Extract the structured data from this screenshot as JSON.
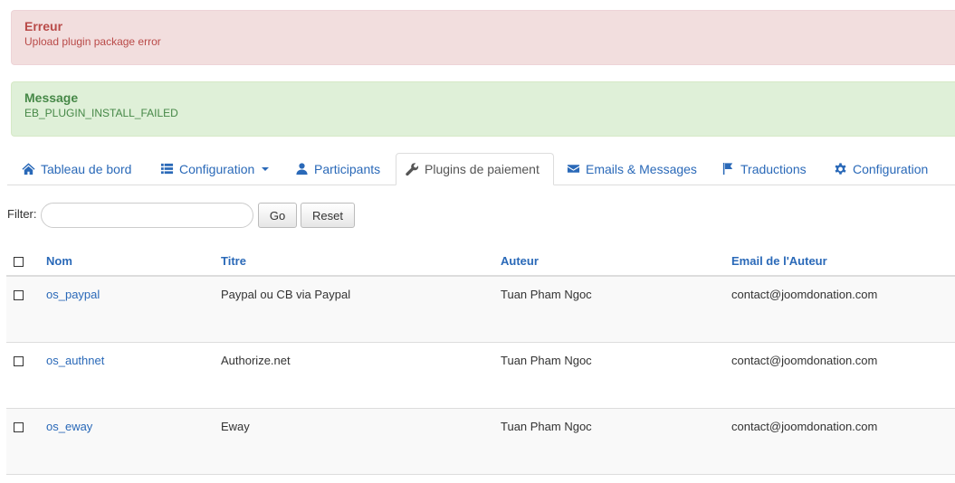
{
  "alerts": {
    "error": {
      "heading": "Erreur",
      "text": "Upload plugin package error"
    },
    "message": {
      "heading": "Message",
      "text": "EB_PLUGIN_INSTALL_FAILED"
    }
  },
  "tabs": [
    {
      "label": "Tableau de bord",
      "icon": "home-icon"
    },
    {
      "label": "Configuration",
      "icon": "list-icon",
      "dropdown": true
    },
    {
      "label": "Participants",
      "icon": "user-icon"
    },
    {
      "label": "Plugins de paiement",
      "icon": "wrench-icon",
      "active": true
    },
    {
      "label": "Emails & Messages",
      "icon": "envelope-icon"
    },
    {
      "label": "Traductions",
      "icon": "flag-icon"
    },
    {
      "label": "Configuration",
      "icon": "cog-icon"
    }
  ],
  "filter": {
    "label": "Filter:",
    "value": "",
    "go": "Go",
    "reset": "Reset"
  },
  "table": {
    "headers": {
      "nom": "Nom",
      "titre": "Titre",
      "auteur": "Auteur",
      "email": "Email de l'Auteur"
    },
    "rows": [
      {
        "nom": "os_paypal",
        "titre": "Paypal ou CB via Paypal",
        "auteur": "Tuan Pham Ngoc",
        "email": "contact@joomdonation.com"
      },
      {
        "nom": "os_authnet",
        "titre": "Authorize.net",
        "auteur": "Tuan Pham Ngoc",
        "email": "contact@joomdonation.com"
      },
      {
        "nom": "os_eway",
        "titre": "Eway",
        "auteur": "Tuan Pham Ngoc",
        "email": "contact@joomdonation.com"
      }
    ]
  }
}
